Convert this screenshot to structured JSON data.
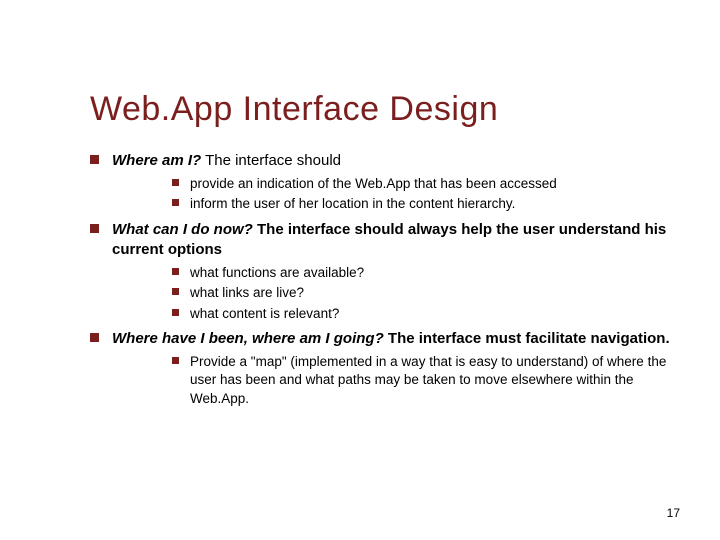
{
  "title": "Web.App Interface Design",
  "points": [
    {
      "emph": "Where am I?",
      "rest": "  The interface should",
      "subs": [
        "provide an indication of the Web.App that has been accessed",
        "inform the user of her location in the content hierarchy."
      ]
    },
    {
      "emph": "What can I do now?",
      "rest": " The interface should always help the user understand his current options",
      "bold_rest": true,
      "subs": [
        "what functions are available?",
        "what links are live?",
        "what content is relevant?"
      ]
    },
    {
      "emph": "Where have I been, where am I going?",
      "rest": "  The interface must facilitate navigation.",
      "bold_rest": true,
      "subs": [
        "Provide a \"map\" (implemented in a way that is easy to understand) of where the user has been and what paths may be taken to move elsewhere within the Web.App."
      ]
    }
  ],
  "page_number": "17"
}
